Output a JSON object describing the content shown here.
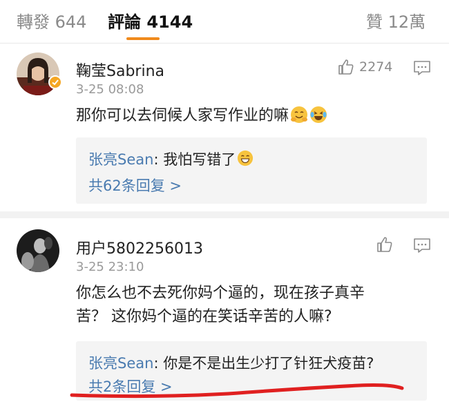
{
  "tabs": {
    "reposts": "轉發 644",
    "comments": "評論 4144",
    "likes": "贊 12萬"
  },
  "comments": [
    {
      "username": "鞠莹Sabrina",
      "timestamp": "3-25 08:08",
      "like_count": "2274",
      "text": "那你可以去伺候人家写作业的嘛",
      "emojis": [
        "hug-emoji",
        "laughing-tears-emoji"
      ],
      "verified": true,
      "reply": {
        "author": "张亮Sean",
        "separator": ": ",
        "text": "我怕写错了",
        "emoji": "grin-emoji",
        "count_label": "共62条回复 >"
      }
    },
    {
      "username": "用户5802256013",
      "timestamp": "3-25 23:10",
      "like_count": "",
      "text_line1": "你怎么也不去死你妈个逼的，现在孩子真辛",
      "text_line2": "苦？ 这你妈个逼的在笑话辛苦的人嘛?",
      "verified": false,
      "reply": {
        "author": "张亮Sean",
        "separator": ": ",
        "text": "你是不是出生少打了针狂犬疫苗?",
        "count_label": "共2条回复 >"
      }
    }
  ],
  "colors": {
    "accent": "#f08a1c",
    "link": "#4a7bb0",
    "annotation_red": "#e02020"
  }
}
